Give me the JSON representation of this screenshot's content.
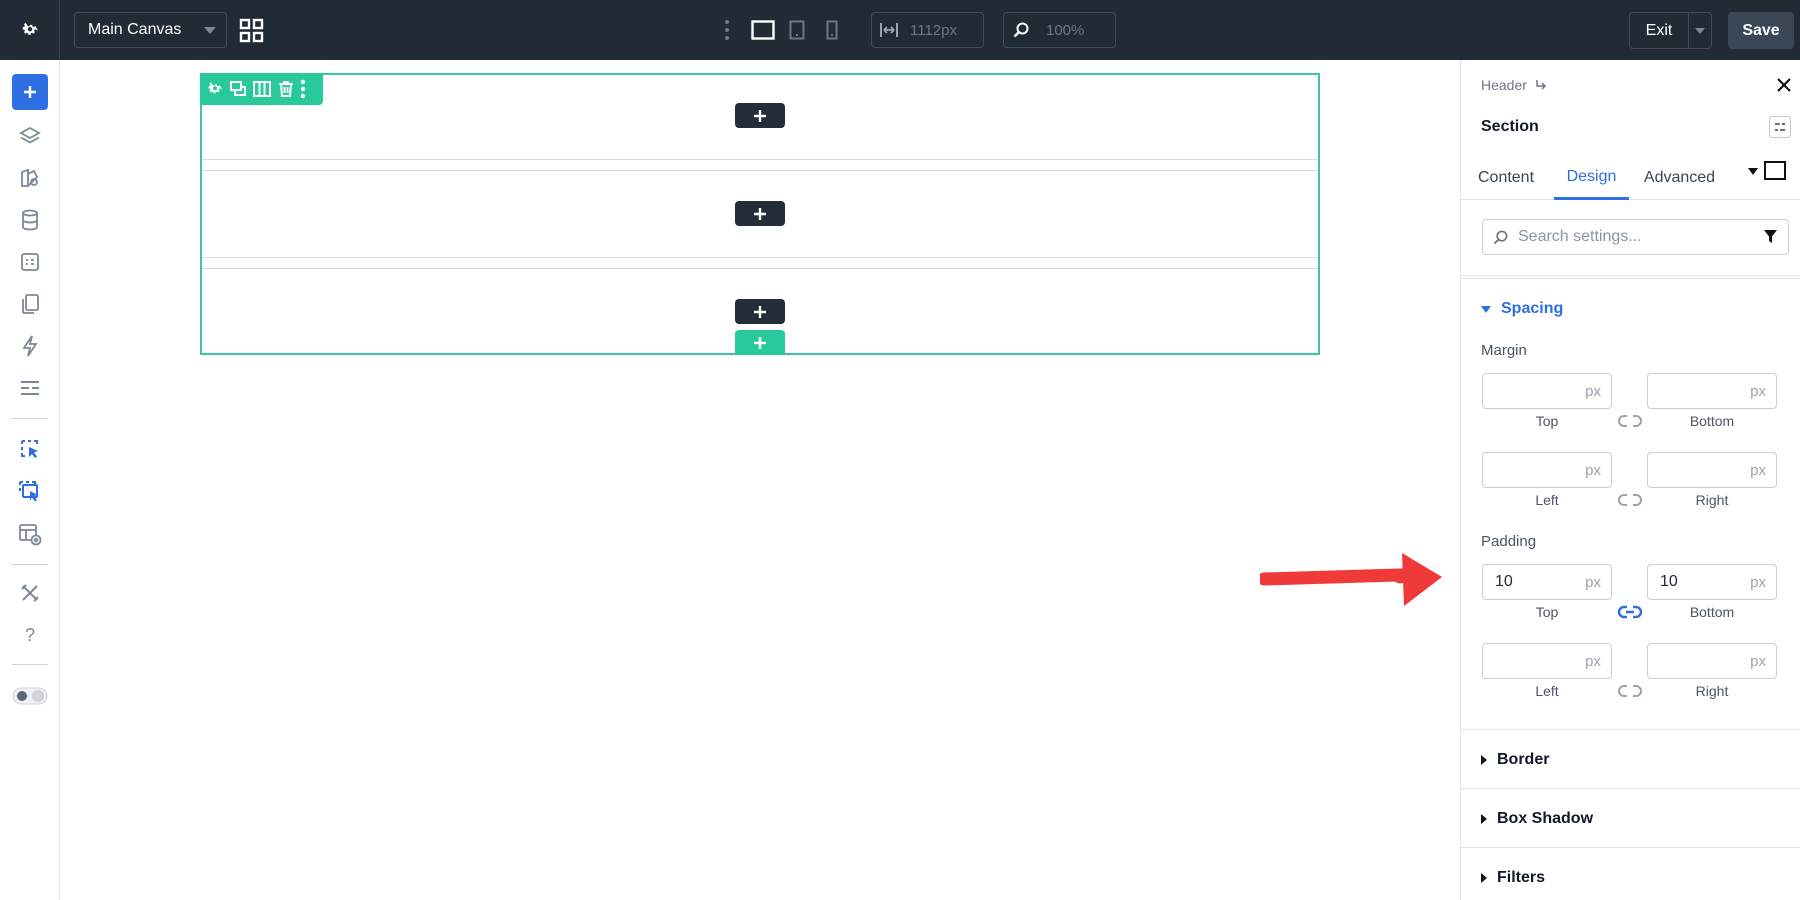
{
  "topbar": {
    "canvas_name": "Main Canvas",
    "width_value": "1112px",
    "zoom_value": "100%",
    "exit_label": "Exit",
    "save_label": "Save"
  },
  "sidebar": {
    "items": [
      "add-icon",
      "layers-icon",
      "palette-icon",
      "database-icon",
      "form-icon",
      "pages-icon",
      "bolt-icon",
      "layout-icon",
      "select-cursor-icon",
      "select-multi-icon",
      "preview-icon",
      "tools-icon",
      "help-icon",
      "theme-toggle"
    ],
    "help_label": "?"
  },
  "canvas": {
    "rows": 3
  },
  "panel": {
    "breadcrumb": "Header",
    "title": "Section",
    "tabs": [
      {
        "label": "Content",
        "active": false
      },
      {
        "label": "Design",
        "active": true
      },
      {
        "label": "Advanced",
        "active": false
      }
    ],
    "search_placeholder": "Search settings...",
    "spacing": {
      "heading": "Spacing",
      "margin_label": "Margin",
      "padding_label": "Padding",
      "unit": "px",
      "caption_top": "Top",
      "caption_bottom": "Bottom",
      "caption_left": "Left",
      "caption_right": "Right",
      "margin": {
        "top": "",
        "bottom": "",
        "left": "",
        "right": ""
      },
      "padding": {
        "top": "10",
        "bottom": "10",
        "left": "",
        "right": ""
      }
    },
    "groups": [
      "Border",
      "Box Shadow",
      "Filters"
    ]
  },
  "colors": {
    "accent": "#2f6fe4",
    "section_green": "#28c99a",
    "topbar": "#212b36",
    "annotation_arrow": "#f03a3a"
  }
}
